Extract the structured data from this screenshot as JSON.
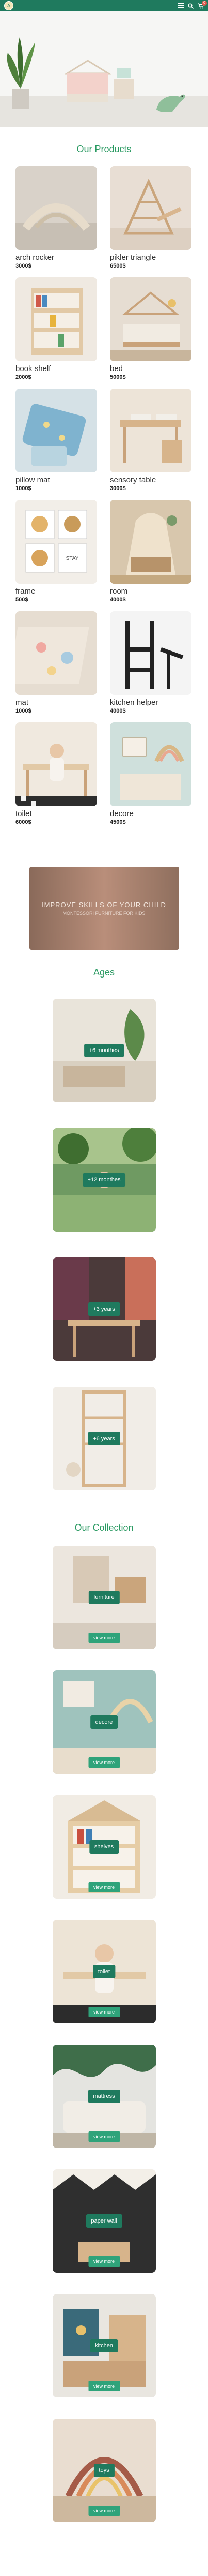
{
  "header": {
    "logo_text": "A",
    "cart_count": "0",
    "icons": [
      "menu-icon",
      "search-icon",
      "cart-icon"
    ]
  },
  "products_section": {
    "title": "Our Products",
    "items": [
      {
        "name": "arch rocker",
        "price": "3000$"
      },
      {
        "name": "pikler triangle",
        "price": "6500$"
      },
      {
        "name": "book shelf",
        "price": "2000$"
      },
      {
        "name": "bed",
        "price": "5000$"
      },
      {
        "name": "pillow mat",
        "price": "1000$"
      },
      {
        "name": "sensory table",
        "price": "3000$"
      },
      {
        "name": "frame",
        "price": "500$"
      },
      {
        "name": "room",
        "price": "4000$"
      },
      {
        "name": "mat",
        "price": "1000$"
      },
      {
        "name": "kitchen helper",
        "price": "4000$"
      },
      {
        "name": "toilet",
        "price": "6000$"
      },
      {
        "name": "decore",
        "price": "4500$"
      }
    ]
  },
  "banner": {
    "line1": "IMPROVE SKILLS OF YOUR CHILD",
    "line2": "MONTESSORI FURNITURE FOR KIDS"
  },
  "ages_section": {
    "title": "Ages",
    "items": [
      {
        "label": "+6 monthes"
      },
      {
        "label": "+12 monthes"
      },
      {
        "label": "+3 years"
      },
      {
        "label": "+6 years"
      }
    ]
  },
  "collection_section": {
    "title": "Our Collection",
    "view_more": "view more",
    "items": [
      {
        "label": "furniture"
      },
      {
        "label": "decore"
      },
      {
        "label": "shelves"
      },
      {
        "label": "toilet"
      },
      {
        "label": "mattress"
      },
      {
        "label": "paper wall"
      },
      {
        "label": "kitchen"
      },
      {
        "label": "toys"
      }
    ]
  },
  "colors": {
    "brand_green": "#1f7a5e",
    "title_green": "#2a9a62",
    "button_green": "#2fa37a"
  }
}
